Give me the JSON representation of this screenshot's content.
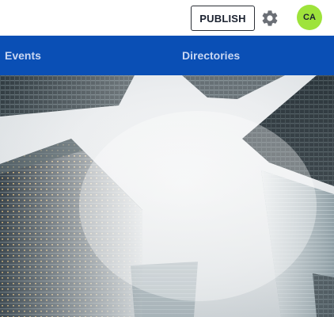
{
  "header": {
    "publish_label": "PUBLISH",
    "settings_icon": "gear-icon",
    "avatar_initials": "CA",
    "avatar_color": "#9ee33b"
  },
  "nav": {
    "background": "#0a4fb5",
    "items": [
      {
        "label": "Events"
      },
      {
        "label": "Directories"
      }
    ]
  },
  "hero": {
    "image": "fog-skyscrapers-looking-up"
  }
}
